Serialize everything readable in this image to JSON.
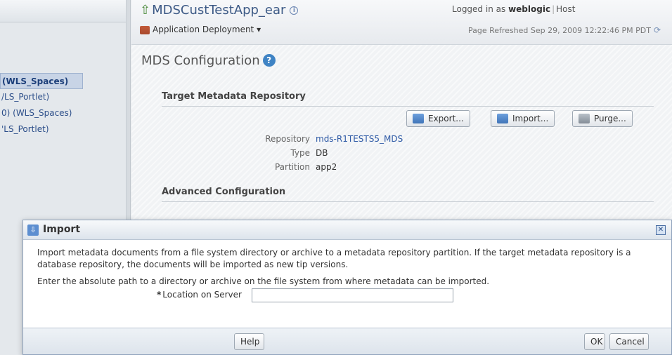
{
  "left_nav": {
    "items": [
      {
        "label": "(WLS_Spaces)",
        "selected": true
      },
      {
        "label": "/LS_Portlet)",
        "selected": false
      },
      {
        "label": "0) (WLS_Spaces)",
        "selected": false
      },
      {
        "label": "'LS_Portlet)",
        "selected": false
      }
    ]
  },
  "header": {
    "app_title": "MDSCustTestApp_ear",
    "menu_label": "Application Deployment",
    "logged_in_prefix": "Logged in as",
    "user": "weblogic",
    "host_label": "Host",
    "refreshed": "Page Refreshed Sep 29, 2009 12:22:46 PM PDT"
  },
  "page": {
    "title": "MDS Configuration",
    "help_glyph": "?",
    "target_section": "Target Metadata Repository",
    "buttons": {
      "export": "Export...",
      "import": "Import...",
      "purge": "Purge..."
    },
    "properties": [
      {
        "label": "Repository",
        "value": "mds-R1TESTS5_MDS",
        "link": true
      },
      {
        "label": "Type",
        "value": "DB",
        "link": false
      },
      {
        "label": "Partition",
        "value": "app2",
        "link": false
      }
    ],
    "advanced_section": "Advanced Configuration"
  },
  "dialog": {
    "title": "Import",
    "description": "Import metadata documents from a file system directory or archive to a metadata repository partition. If the target metadata repository is a database repository, the documents will be imported as new tip versions.",
    "instruction": "Enter the absolute path to a directory or archive on the file system from where metadata can be imported.",
    "location_label": "Location on Server",
    "required_mark": "*",
    "location_value": "",
    "help_button": "Help",
    "ok_button": "OK",
    "cancel_button": "Cancel"
  },
  "colors": {
    "accent": "#3d5a86",
    "link": "#2e5aa6",
    "help_blue": "#3f83c4"
  }
}
